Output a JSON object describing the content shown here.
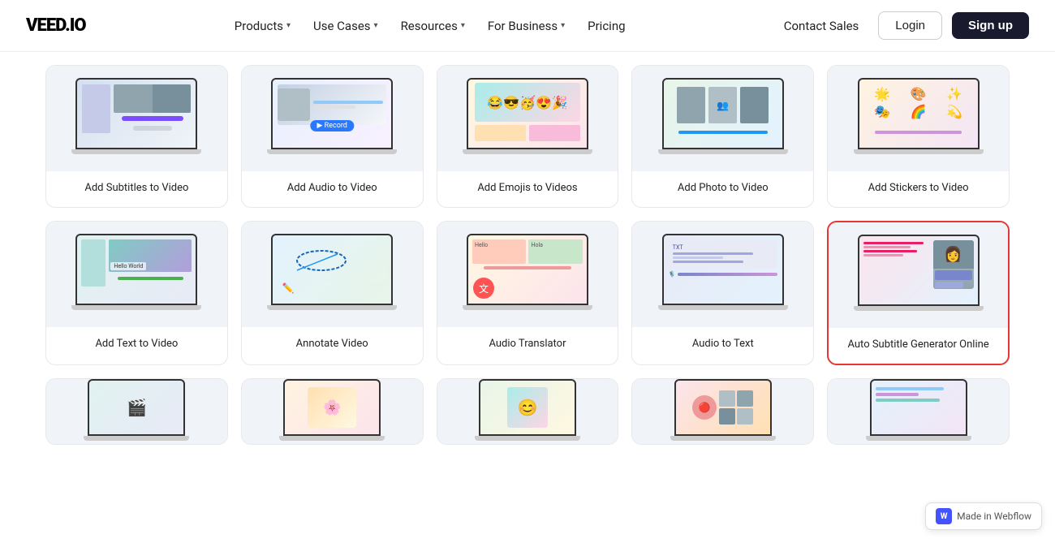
{
  "header": {
    "logo": "VEED.IO",
    "nav": [
      {
        "label": "Products",
        "has_dropdown": true
      },
      {
        "label": "Use Cases",
        "has_dropdown": true
      },
      {
        "label": "Resources",
        "has_dropdown": true
      },
      {
        "label": "For Business",
        "has_dropdown": true
      },
      {
        "label": "Pricing",
        "has_dropdown": false
      }
    ],
    "contact_sales": "Contact Sales",
    "login": "Login",
    "signup": "Sign up"
  },
  "cards_row1": [
    {
      "label": "Add Subtitles to Video",
      "screen_class": "sc-subtitles",
      "type": "person_text"
    },
    {
      "label": "Add Audio to Video",
      "screen_class": "sc-audio",
      "type": "person_badge"
    },
    {
      "label": "Add Emojis to Videos",
      "screen_class": "sc-emojis",
      "type": "emojis"
    },
    {
      "label": "Add Photo to Video",
      "screen_class": "sc-photo",
      "type": "meeting"
    },
    {
      "label": "Add Stickers to Video",
      "screen_class": "sc-stickers",
      "type": "stickers"
    }
  ],
  "cards_row2": [
    {
      "label": "Add Text to Video",
      "screen_class": "sc-text",
      "type": "person_text"
    },
    {
      "label": "Annotate Video",
      "screen_class": "sc-annotate",
      "type": "annotate"
    },
    {
      "label": "Audio Translator",
      "screen_class": "sc-translator",
      "type": "translator"
    },
    {
      "label": "Audio to Text",
      "screen_class": "sc-a2t",
      "type": "a2t"
    },
    {
      "label": "Auto Subtitle Generator\nOnline",
      "screen_class": "sc-autosubtitle",
      "type": "autosubtitle",
      "highlighted": true
    }
  ],
  "cards_row3_partial": [
    {
      "label": "",
      "screen_class": "sc-r1"
    },
    {
      "label": "",
      "screen_class": "sc-r2"
    },
    {
      "label": "",
      "screen_class": "sc-r3"
    },
    {
      "label": "",
      "screen_class": "sc-r4"
    },
    {
      "label": "",
      "screen_class": "sc-r5"
    }
  ],
  "webflow_badge": "Made in Webflow"
}
